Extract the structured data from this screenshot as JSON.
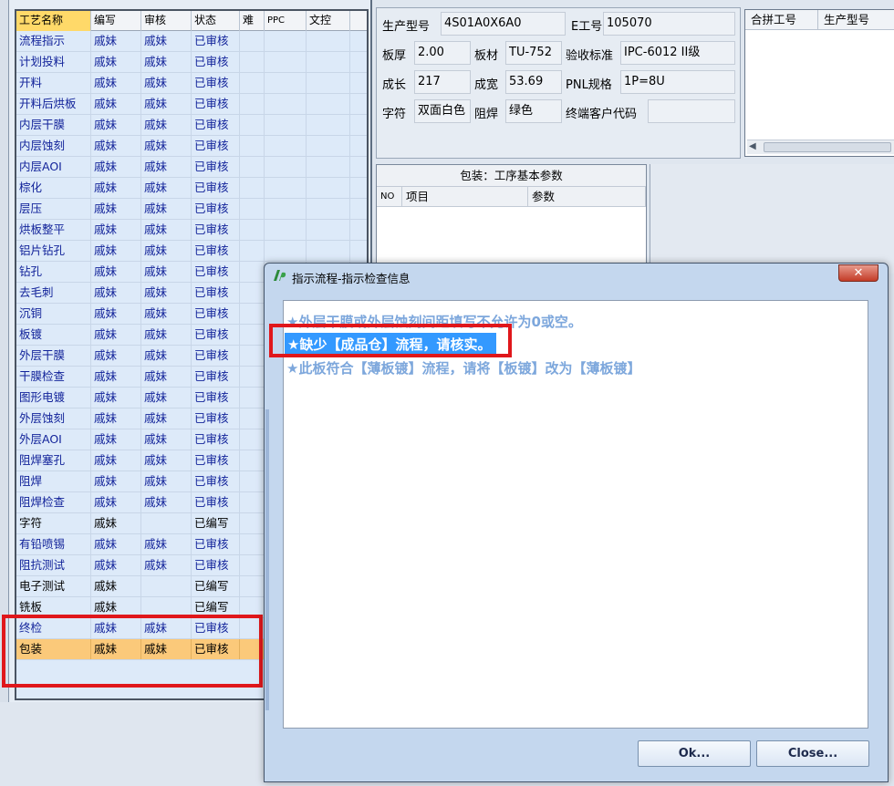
{
  "grid": {
    "columns": [
      "工艺名称",
      "编写",
      "审核",
      "状态",
      "难",
      "PPC",
      "文控"
    ],
    "rows": [
      [
        "流程指示",
        "戚妹",
        "戚妹",
        "已审核"
      ],
      [
        "计划投料",
        "戚妹",
        "戚妹",
        "已审核"
      ],
      [
        "开料",
        "戚妹",
        "戚妹",
        "已审核"
      ],
      [
        "开料后烘板",
        "戚妹",
        "戚妹",
        "已审核"
      ],
      [
        "内层干膜",
        "戚妹",
        "戚妹",
        "已审核"
      ],
      [
        "内层蚀刻",
        "戚妹",
        "戚妹",
        "已审核"
      ],
      [
        "内层AOI",
        "戚妹",
        "戚妹",
        "已审核"
      ],
      [
        "棕化",
        "戚妹",
        "戚妹",
        "已审核"
      ],
      [
        "层压",
        "戚妹",
        "戚妹",
        "已审核"
      ],
      [
        "烘板整平",
        "戚妹",
        "戚妹",
        "已审核"
      ],
      [
        "铝片钻孔",
        "戚妹",
        "戚妹",
        "已审核"
      ],
      [
        "钻孔",
        "戚妹",
        "戚妹",
        "已审核"
      ],
      [
        "去毛刺",
        "戚妹",
        "戚妹",
        "已审核"
      ],
      [
        "沉铜",
        "戚妹",
        "戚妹",
        "已审核"
      ],
      [
        "板镀",
        "戚妹",
        "戚妹",
        "已审核"
      ],
      [
        "外层干膜",
        "戚妹",
        "戚妹",
        "已审核"
      ],
      [
        "干膜检查",
        "戚妹",
        "戚妹",
        "已审核"
      ],
      [
        "图形电镀",
        "戚妹",
        "戚妹",
        "已审核"
      ],
      [
        "外层蚀刻",
        "戚妹",
        "戚妹",
        "已审核"
      ],
      [
        "外层AOI",
        "戚妹",
        "戚妹",
        "已审核"
      ],
      [
        "阻焊塞孔",
        "戚妹",
        "戚妹",
        "已审核"
      ],
      [
        "阻焊",
        "戚妹",
        "戚妹",
        "已审核"
      ],
      [
        "阻焊检查",
        "戚妹",
        "戚妹",
        "已审核"
      ],
      [
        "字符",
        "戚妹",
        "",
        "已编写"
      ],
      [
        "有铅喷锡",
        "戚妹",
        "戚妹",
        "已审核"
      ],
      [
        "阻抗测试",
        "戚妹",
        "戚妹",
        "已审核"
      ],
      [
        "电子测试",
        "戚妹",
        "",
        "已编写"
      ],
      [
        "铣板",
        "戚妹",
        "",
        "已编写"
      ],
      [
        "终检",
        "戚妹",
        "戚妹",
        "已审核"
      ],
      [
        "包装",
        "戚妹",
        "戚妹",
        "已审核"
      ]
    ]
  },
  "info": {
    "product_model_label": "生产型号",
    "product_model": "4S01A0X6A0",
    "e_number_label": "E工号",
    "e_number": "105070",
    "thickness_label": "板厚",
    "thickness": "2.00",
    "material_label": "板材",
    "material": "TU-752",
    "standard_label": "验收标准",
    "standard": "IPC-6012 II级",
    "length_label": "成长",
    "length": "217",
    "width_label": "成宽",
    "width": "53.69",
    "pnl_label": "PNL规格",
    "pnl": "1P=8U",
    "legend_label": "字符",
    "legend": "双面白色",
    "solder_label": "阻焊",
    "solder": "绿色",
    "customer_code_label": "终端客户代码",
    "customer_code": ""
  },
  "right_list": {
    "columns": [
      "合拼工号",
      "生产型号"
    ]
  },
  "params": {
    "title": "包装：工序基本参数",
    "columns": [
      "NO",
      "项目",
      "参数"
    ]
  },
  "dialog": {
    "title": "指示流程-指示检查信息",
    "messages": [
      "★外层干膜或外层蚀刻间距填写不允许为0或空。",
      "★缺少【成品仓】流程，请核实。",
      "★此板符合【薄板镀】流程，请将【板镀】改为【薄板镀】"
    ],
    "ok_label": "Ok...",
    "close_label": "Close...",
    "close_x": "✕"
  },
  "colors": {
    "highlight_red": "#e0171b",
    "selected_row": "#fbc97a",
    "message_blue": "#7da7dc",
    "message_selected_bg": "#3399ff",
    "link_text": "#12239a"
  }
}
